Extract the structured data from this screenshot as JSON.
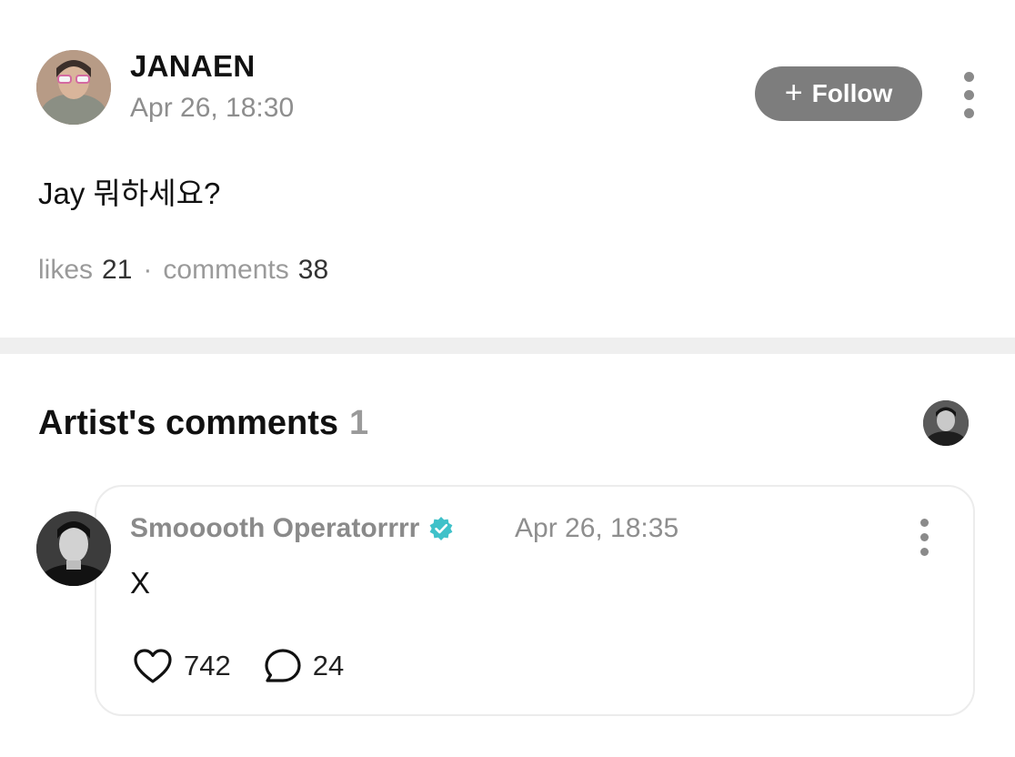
{
  "post": {
    "author": "JANAEN",
    "time": "Apr 26, 18:30",
    "follow_label": "Follow",
    "body": "Jay 뭐하세요?",
    "likes_label": "likes",
    "likes_count": "21",
    "separator": "·",
    "comments_label": "comments",
    "comments_count": "38"
  },
  "artist_comments": {
    "title": "Artist's comments",
    "count": "1",
    "comment": {
      "author": "Smooooth Operatorrrr",
      "time": "Apr 26, 18:35",
      "text": "X",
      "likes": "742",
      "replies": "24",
      "verified_color": "#3fc1c9"
    }
  },
  "icons": [
    "follow-plus-icon",
    "more-vertical-icon",
    "verified-badge-icon",
    "heart-icon",
    "comment-bubble-icon"
  ]
}
